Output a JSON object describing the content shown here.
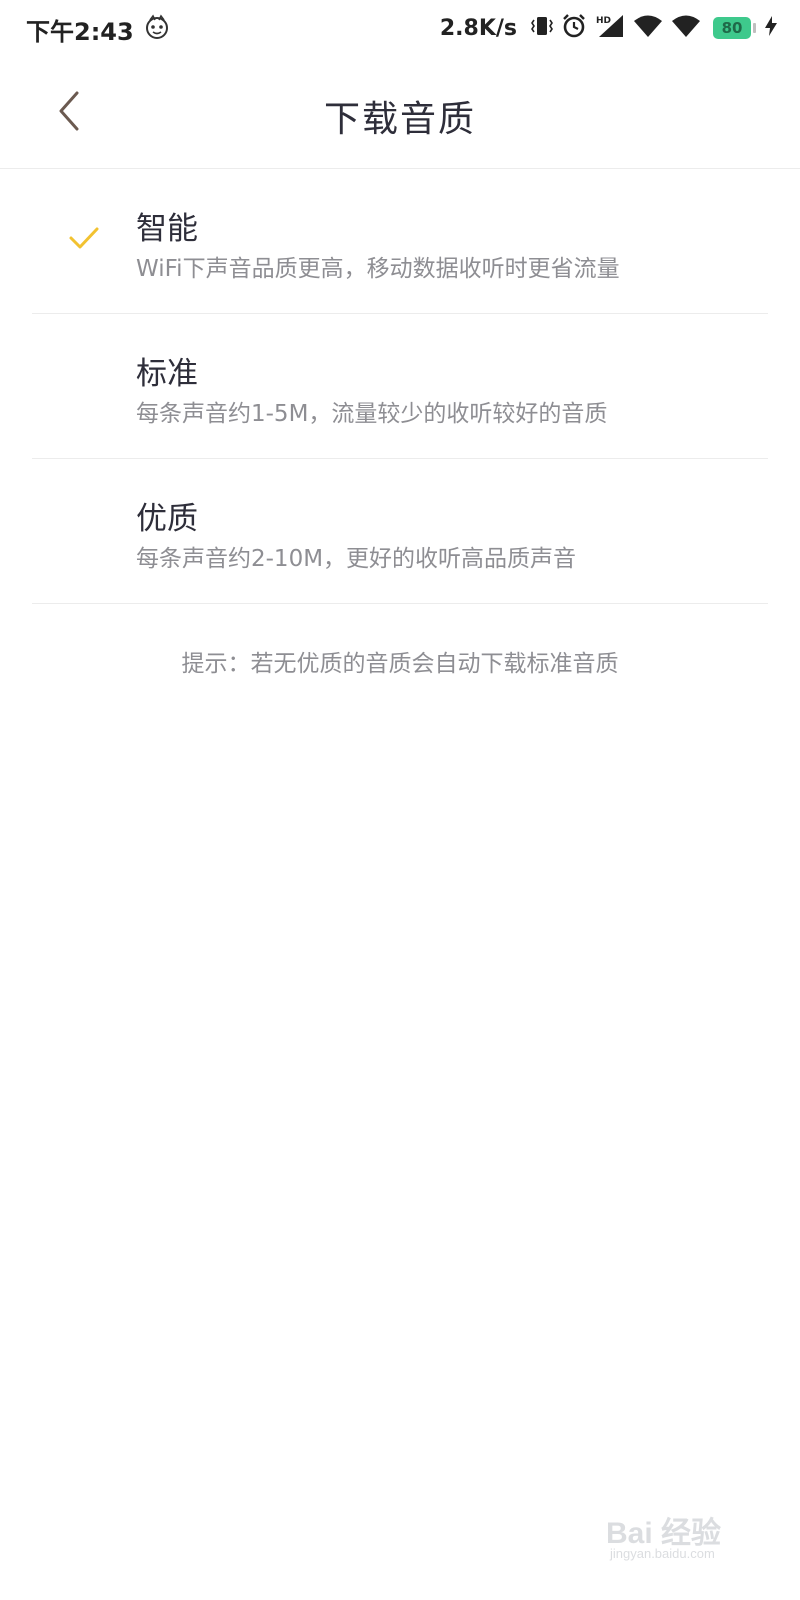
{
  "status_bar": {
    "time": "下午2:43",
    "network_speed": "2.8K/s",
    "battery_level": "80",
    "icons": [
      "app-mascot-icon",
      "vibrate-icon",
      "alarm-icon",
      "hd-signal-icon",
      "wifi-icon",
      "signal-icon",
      "battery-icon",
      "charging-icon"
    ]
  },
  "header": {
    "title": "下载音质",
    "back_icon": "chevron-left-icon"
  },
  "options": [
    {
      "title": "智能",
      "description": "WiFi下声音品质更高，移动数据收听时更省流量",
      "selected": true
    },
    {
      "title": "标准",
      "description": "每条声音约1-5M，流量较少的收听较好的音质",
      "selected": false
    },
    {
      "title": "优质",
      "description": "每条声音约2-10M，更好的收听高品质声音",
      "selected": false
    }
  ],
  "hint": "提示：若无优质的音质会自动下载标准音质",
  "watermark": {
    "brand": "Bai 经验",
    "url": "jingyan.baidu.com"
  },
  "colors": {
    "check": "#f2c230",
    "back_arrow": "#6b5a50",
    "battery": "#3ec98c"
  }
}
